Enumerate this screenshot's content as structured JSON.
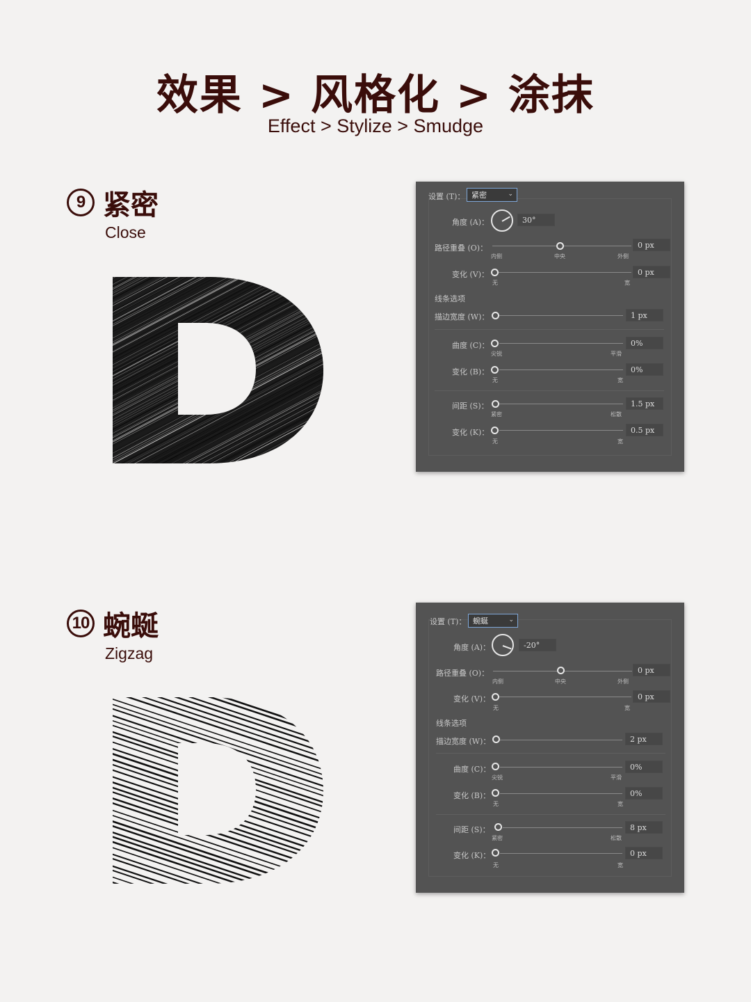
{
  "header": {
    "title": "效果 > 风格化 > 涂抹",
    "subtitle": "Effect > Stylize > Smudge"
  },
  "sections": [
    {
      "number": "9",
      "cn": "紧密",
      "en": "Close",
      "letter": "D",
      "panel": {
        "preset_label": "设置 (T)：",
        "preset_value": "紧密",
        "angle_label": "角度 (A)：",
        "angle_value": "30°",
        "path_overlap_label": "路径重叠 (O)：",
        "path_overlap_value": "0 px",
        "path_overlap_ticks": [
          "内侧",
          "中央",
          "外侧"
        ],
        "variation_v_label": "变化 (V)：",
        "variation_v_value": "0 px",
        "variation_v_ticks": [
          "无",
          "宽"
        ],
        "line_options_label": "线条选项",
        "stroke_width_label": "描边宽度 (W)：",
        "stroke_width_value": "1 px",
        "curviness_label": "曲度 (C)：",
        "curviness_value": "0%",
        "curviness_ticks": [
          "尖锐",
          "平滑"
        ],
        "variation_b_label": "变化 (B)：",
        "variation_b_value": "0%",
        "variation_b_ticks": [
          "无",
          "宽"
        ],
        "spacing_label": "间距 (S)：",
        "spacing_value": "1.5 px",
        "spacing_ticks": [
          "紧密",
          "松散"
        ],
        "variation_k_label": "变化 (K)：",
        "variation_k_value": "0.5 px",
        "variation_k_ticks": [
          "无",
          "宽"
        ]
      }
    },
    {
      "number": "10",
      "cn": "蜿蜒",
      "en": "Zigzag",
      "letter": "D",
      "panel": {
        "preset_label": "设置 (T)：",
        "preset_value": "蜿蜒",
        "angle_label": "角度 (A)：",
        "angle_value": "-20°",
        "path_overlap_label": "路径重叠 (O)：",
        "path_overlap_value": "0 px",
        "path_overlap_ticks": [
          "内侧",
          "中央",
          "外侧"
        ],
        "variation_v_label": "变化 (V)：",
        "variation_v_value": "0 px",
        "variation_v_ticks": [
          "无",
          "宽"
        ],
        "line_options_label": "线条选项",
        "stroke_width_label": "描边宽度 (W)：",
        "stroke_width_value": "2 px",
        "curviness_label": "曲度 (C)：",
        "curviness_value": "0%",
        "curviness_ticks": [
          "尖锐",
          "平滑"
        ],
        "variation_b_label": "变化 (B)：",
        "variation_b_value": "0%",
        "variation_b_ticks": [
          "无",
          "宽"
        ],
        "spacing_label": "间距 (S)：",
        "spacing_value": "8 px",
        "spacing_ticks": [
          "紧密",
          "松散"
        ],
        "variation_k_label": "变化 (K)：",
        "variation_k_value": "0 px",
        "variation_k_ticks": [
          "无",
          "宽"
        ]
      }
    }
  ],
  "colors": {
    "accent": "#3a0d0a",
    "panel_bg": "#535353",
    "page_bg": "#f3f2f1"
  }
}
